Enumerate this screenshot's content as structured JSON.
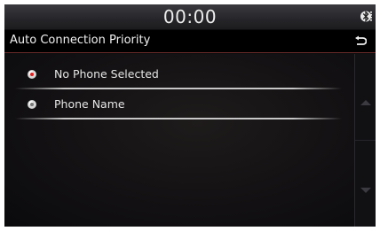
{
  "status": {
    "clock": "00:00",
    "bluetooth_icon": "bluetooth-icon"
  },
  "header": {
    "title": "Auto Connection Priority",
    "back_icon": "back-arrow-icon"
  },
  "list": {
    "items": [
      {
        "label": "No Phone Selected",
        "selected": true
      },
      {
        "label": "Phone Name",
        "selected": false
      }
    ]
  },
  "scroll": {
    "up_icon": "scroll-up-icon",
    "down_icon": "scroll-down-icon"
  },
  "colors": {
    "accent": "#e02020",
    "header_border": "#6a2a2a",
    "background": "#0d0d0f"
  }
}
